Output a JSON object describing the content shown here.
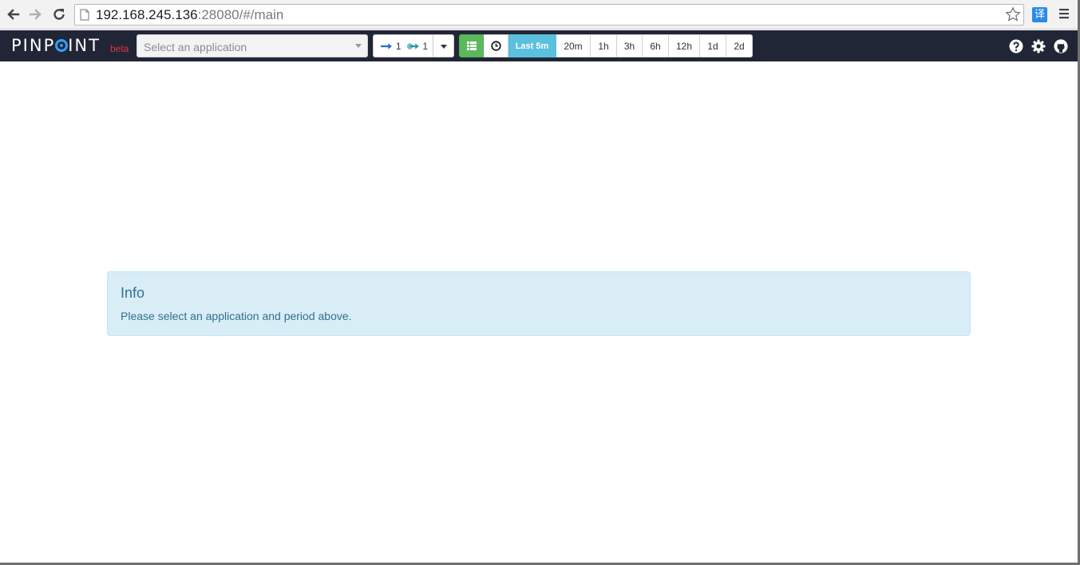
{
  "browser": {
    "url_host": "192.168.245.136",
    "url_rest": ":28080/#/main",
    "translate_label": "译"
  },
  "navbar": {
    "logo_left": "PINP",
    "logo_right": "INT",
    "beta_label": "beta",
    "app_select_placeholder": "Select an application",
    "inbound_depth": "1",
    "outbound_depth": "1",
    "periods": {
      "last5m": "Last 5m",
      "p20m": "20m",
      "p1h": "1h",
      "p3h": "3h",
      "p6h": "6h",
      "p12h": "12h",
      "p1d": "1d",
      "p2d": "2d"
    },
    "selected_period": "Last 5m"
  },
  "info": {
    "title": "Info",
    "message": "Please select an application and period above."
  },
  "colors": {
    "navbar_bg": "#212636",
    "accent_blue": "#5bc0de",
    "green": "#5cb85c",
    "beta_red": "#e0343a",
    "info_bg": "#d9edf7",
    "info_text": "#31708f"
  }
}
